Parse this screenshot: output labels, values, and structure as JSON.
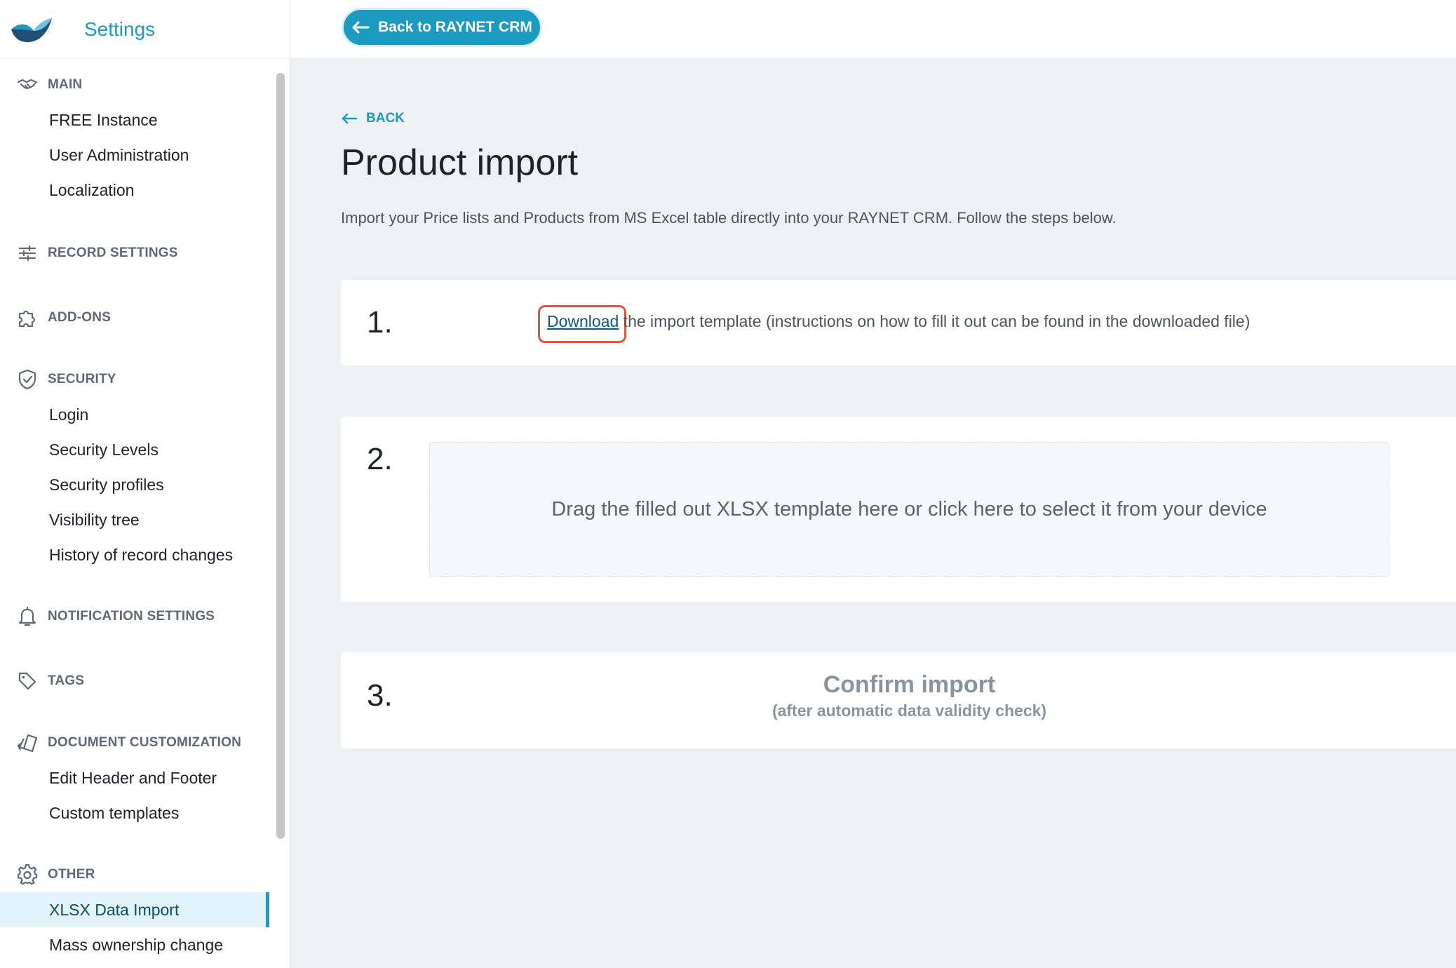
{
  "app": {
    "title": "Settings",
    "logo_icon": "raynet-bird-logo",
    "accent_color": "#1c9ac0"
  },
  "topbar": {
    "back_to_crm_label": "Back to RAYNET CRM"
  },
  "sidebar": {
    "sections": [
      {
        "label": "MAIN",
        "icon": "handshake-icon",
        "items": [
          "FREE Instance",
          "User Administration",
          "Localization"
        ]
      },
      {
        "label": "RECORD SETTINGS",
        "icon": "sliders-icon",
        "items": []
      },
      {
        "label": "ADD-ONS",
        "icon": "puzzle-icon",
        "items": []
      },
      {
        "label": "SECURITY",
        "icon": "shield-check-icon",
        "items": [
          "Login",
          "Security Levels",
          "Security profiles",
          "Visibility tree",
          "History of record changes"
        ]
      },
      {
        "label": "NOTIFICATION SETTINGS",
        "icon": "bell-icon",
        "items": []
      },
      {
        "label": "TAGS",
        "icon": "tag-icon",
        "items": []
      },
      {
        "label": "DOCUMENT CUSTOMIZATION",
        "icon": "palette-icon",
        "items": [
          "Edit Header and Footer",
          "Custom templates"
        ]
      },
      {
        "label": "OTHER",
        "icon": "gear-icon",
        "items": [
          "XLSX Data Import",
          "Mass ownership change"
        ]
      }
    ],
    "active_item": "XLSX Data Import"
  },
  "main": {
    "back_label": "BACK",
    "title": "Product import",
    "description": "Import your Price lists and Products from MS Excel table directly into your RAYNET CRM. Follow the steps below.",
    "steps": [
      {
        "number": "1.",
        "link_text": "Download",
        "text": " the import template (instructions on how to fill it out can be found in the downloaded file)"
      },
      {
        "number": "2.",
        "dropzone_text": "Drag the filled out XLSX template here or click here to select it from your device"
      },
      {
        "number": "3.",
        "title": "Confirm import",
        "subtitle": "(after automatic data validity check)"
      }
    ]
  }
}
